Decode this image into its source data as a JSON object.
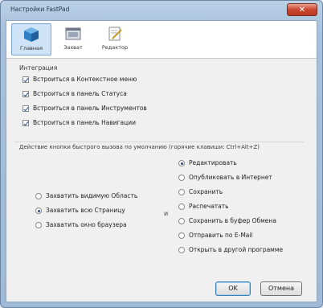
{
  "window": {
    "title": "Настройки FastPad",
    "close_glyph": "✕"
  },
  "toolbar": {
    "tabs": [
      {
        "label": "Главная",
        "icon": "cube-icon",
        "active": true
      },
      {
        "label": "Захват",
        "icon": "window-icon",
        "active": false
      },
      {
        "label": "Редактор",
        "icon": "page-edit-icon",
        "active": false
      }
    ]
  },
  "integration": {
    "title": "Интеграция",
    "items": [
      {
        "label": "Встроиться в Контекстное меню",
        "checked": true
      },
      {
        "label": "Встроиться в панель Статуса",
        "checked": true
      },
      {
        "label": "Встроиться в панель Инструментов",
        "checked": true
      },
      {
        "label": "Встроиться в панель Навигации",
        "checked": true
      }
    ]
  },
  "hotkey": {
    "title": "Действие кнопки быстрого вызова по умолчанию (горячие клавиши: Ctrl+Alt+Z)"
  },
  "capture": {
    "items": [
      {
        "label": "Захватить видимую Область",
        "checked": false
      },
      {
        "label": "Захватить всю Страницу",
        "checked": true
      },
      {
        "label": "Захватить окно браузера",
        "checked": false
      }
    ],
    "connector": "и"
  },
  "action": {
    "items": [
      {
        "label": "Редактировать",
        "checked": true
      },
      {
        "label": "Опубликовать в Интернет",
        "checked": false
      },
      {
        "label": "Сохранить",
        "checked": false
      },
      {
        "label": "Распечатать",
        "checked": false
      },
      {
        "label": "Сохранить в буфер Обмена",
        "checked": false
      },
      {
        "label": "Отправить по E-Mail",
        "checked": false
      },
      {
        "label": "Открыть в другой программе",
        "checked": false
      }
    ]
  },
  "buttons": {
    "ok": "OK",
    "cancel": "Отмена"
  },
  "colors": {
    "title_bar": "#a6c1dc",
    "close_button": "#c9472f",
    "active_tab": "#cfe3f7",
    "panel": "#f0f0f0"
  }
}
